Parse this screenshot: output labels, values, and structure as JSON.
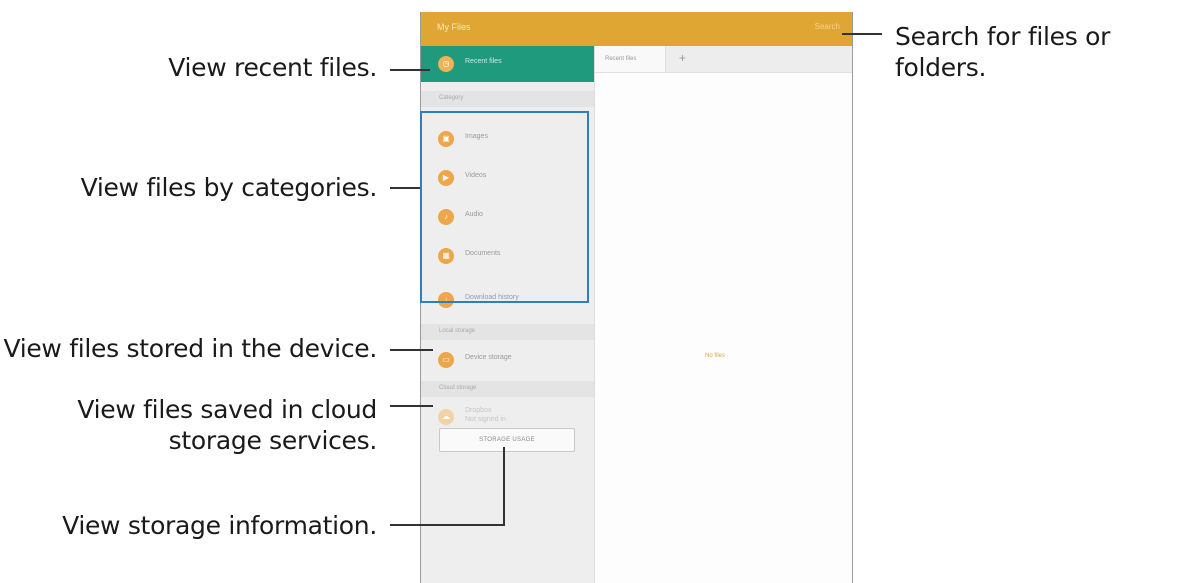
{
  "callouts": {
    "search": "Search for files or folders.",
    "recent": "View recent files.",
    "categories": "View files by categories.",
    "device": "View files stored in the device.",
    "cloud": [
      "View files saved in cloud",
      "storage services."
    ],
    "storage_info": "View storage information."
  },
  "screen": {
    "app_title": "My Files",
    "search_action": "Search",
    "drawer": {
      "recent_files": "Recent files",
      "category_header": "Category",
      "categories": [
        "Images",
        "Videos",
        "Audio",
        "Documents",
        "Download history"
      ],
      "local_header": "Local storage",
      "device_storage": "Device storage",
      "cloud_header": "Cloud storage",
      "cloud_item": [
        "Dropbox",
        "Not signed in"
      ],
      "storage_usage_button": "STORAGE USAGE"
    },
    "tab_label": "Recent files",
    "tab_add": "+",
    "empty_state": "No files"
  },
  "colors": {
    "app_bar": "#e0a633",
    "active_item": "#1f9a7d",
    "icon_orange": "#eda64a",
    "highlight_border": "#2b7fc3"
  },
  "icons": {
    "recent": "clock-icon",
    "images": "image-icon",
    "videos": "video-icon",
    "audio": "music-note-icon",
    "documents": "document-icon",
    "downloads": "download-icon",
    "device": "device-storage-icon",
    "cloud": "cloud-icon"
  }
}
